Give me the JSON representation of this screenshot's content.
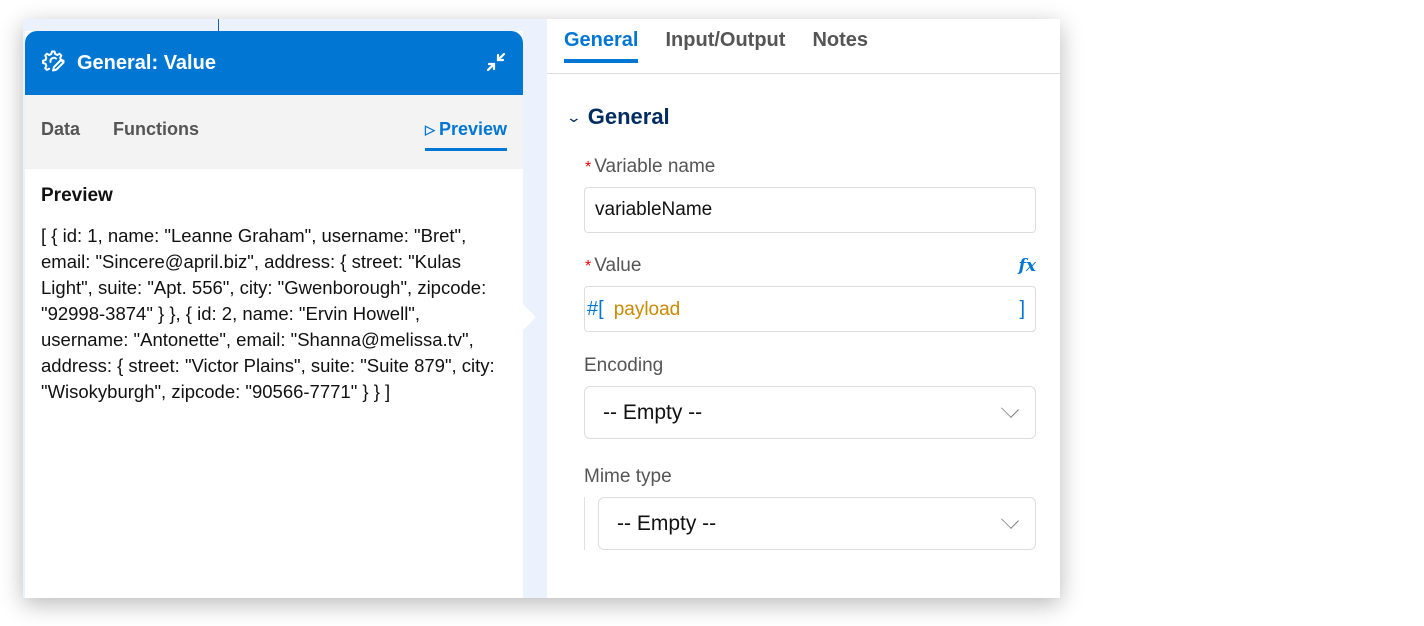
{
  "card": {
    "title": "General: Value",
    "icons": {
      "header": "gear-edit-icon",
      "collapse": "collapse-icon"
    },
    "tabs": [
      {
        "label": "Data",
        "active": false
      },
      {
        "label": "Functions",
        "active": false
      },
      {
        "label": "Preview",
        "active": true,
        "icon": "play-icon"
      }
    ],
    "preview": {
      "heading": "Preview",
      "content": "[ { id: 1, name: \"Leanne Graham\", username: \"Bret\", email: \"Sincere@april.biz\", address: { street: \"Kulas Light\", suite: \"Apt. 556\", city: \"Gwenborough\", zipcode: \"92998-3874\" } }, { id: 2, name: \"Ervin Howell\", username: \"Antonette\", email: \"Shanna@melissa.tv\", address: { street: \"Victor Plains\", suite: \"Suite 879\", city: \"Wisokyburgh\", zipcode: \"90566-7771\" } } ]"
    }
  },
  "panel": {
    "tabs": [
      {
        "label": "General",
        "active": true
      },
      {
        "label": "Input/Output",
        "active": false
      },
      {
        "label": "Notes",
        "active": false
      }
    ],
    "section": {
      "title": "General",
      "fields": {
        "variable_name": {
          "label": "Variable name",
          "required": "*",
          "value": "variableName"
        },
        "value": {
          "label": "Value",
          "required": "*",
          "fx_label": "fx",
          "prefix": "#[",
          "expression": "payload",
          "suffix": "]"
        },
        "encoding": {
          "label": "Encoding",
          "selected": "-- Empty --"
        },
        "mime_type": {
          "label": "Mime type",
          "selected": "-- Empty --"
        }
      }
    }
  },
  "colors": {
    "accent": "#0176d3",
    "section_title": "#032d60",
    "expression": "#c98a00",
    "required": "#ee0000",
    "canvas": "#ebf2fd"
  }
}
